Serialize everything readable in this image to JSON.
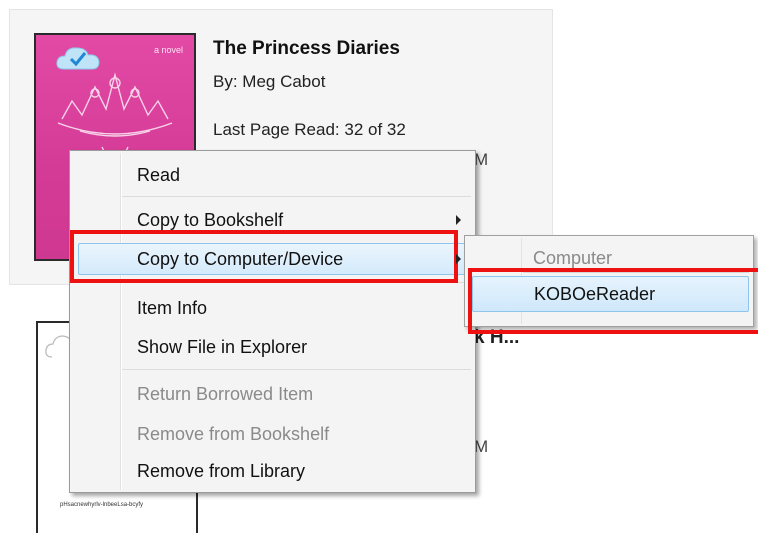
{
  "book1": {
    "title": "The Princess Diaries",
    "author": "By:  Meg Cabot",
    "last_page_read": "Last Page Read:  32 of 32",
    "partial_text": "M",
    "cover_small_text": "a novel"
  },
  "book2": {
    "partial_title": "k H...",
    "partial_text": "M",
    "cover_text": "pHsacnewhyrlv-lnbeeLsa-bcyfy"
  },
  "context_menu": {
    "items": [
      {
        "label": "Read"
      },
      {
        "label": "Copy to Bookshelf"
      },
      {
        "label": "Copy to Computer/Device"
      },
      {
        "label": "Item Info"
      },
      {
        "label": "Show File in Explorer"
      },
      {
        "label": "Return Borrowed Item"
      },
      {
        "label": "Remove from Bookshelf"
      },
      {
        "label": "Remove from Library"
      }
    ],
    "selected": "Copy to Computer/Device"
  },
  "submenu": {
    "header": "Computer",
    "items": [
      {
        "label": "KOBOeReader"
      }
    ]
  },
  "colors": {
    "annotation_red": "#ee1111",
    "cover_pink": "#d43b97",
    "highlight_blue": "#d4eafb"
  },
  "icons": [
    "cloud-check-icon",
    "submenu-arrow-icon",
    "cloud-icon",
    "tiara-illustration"
  ]
}
